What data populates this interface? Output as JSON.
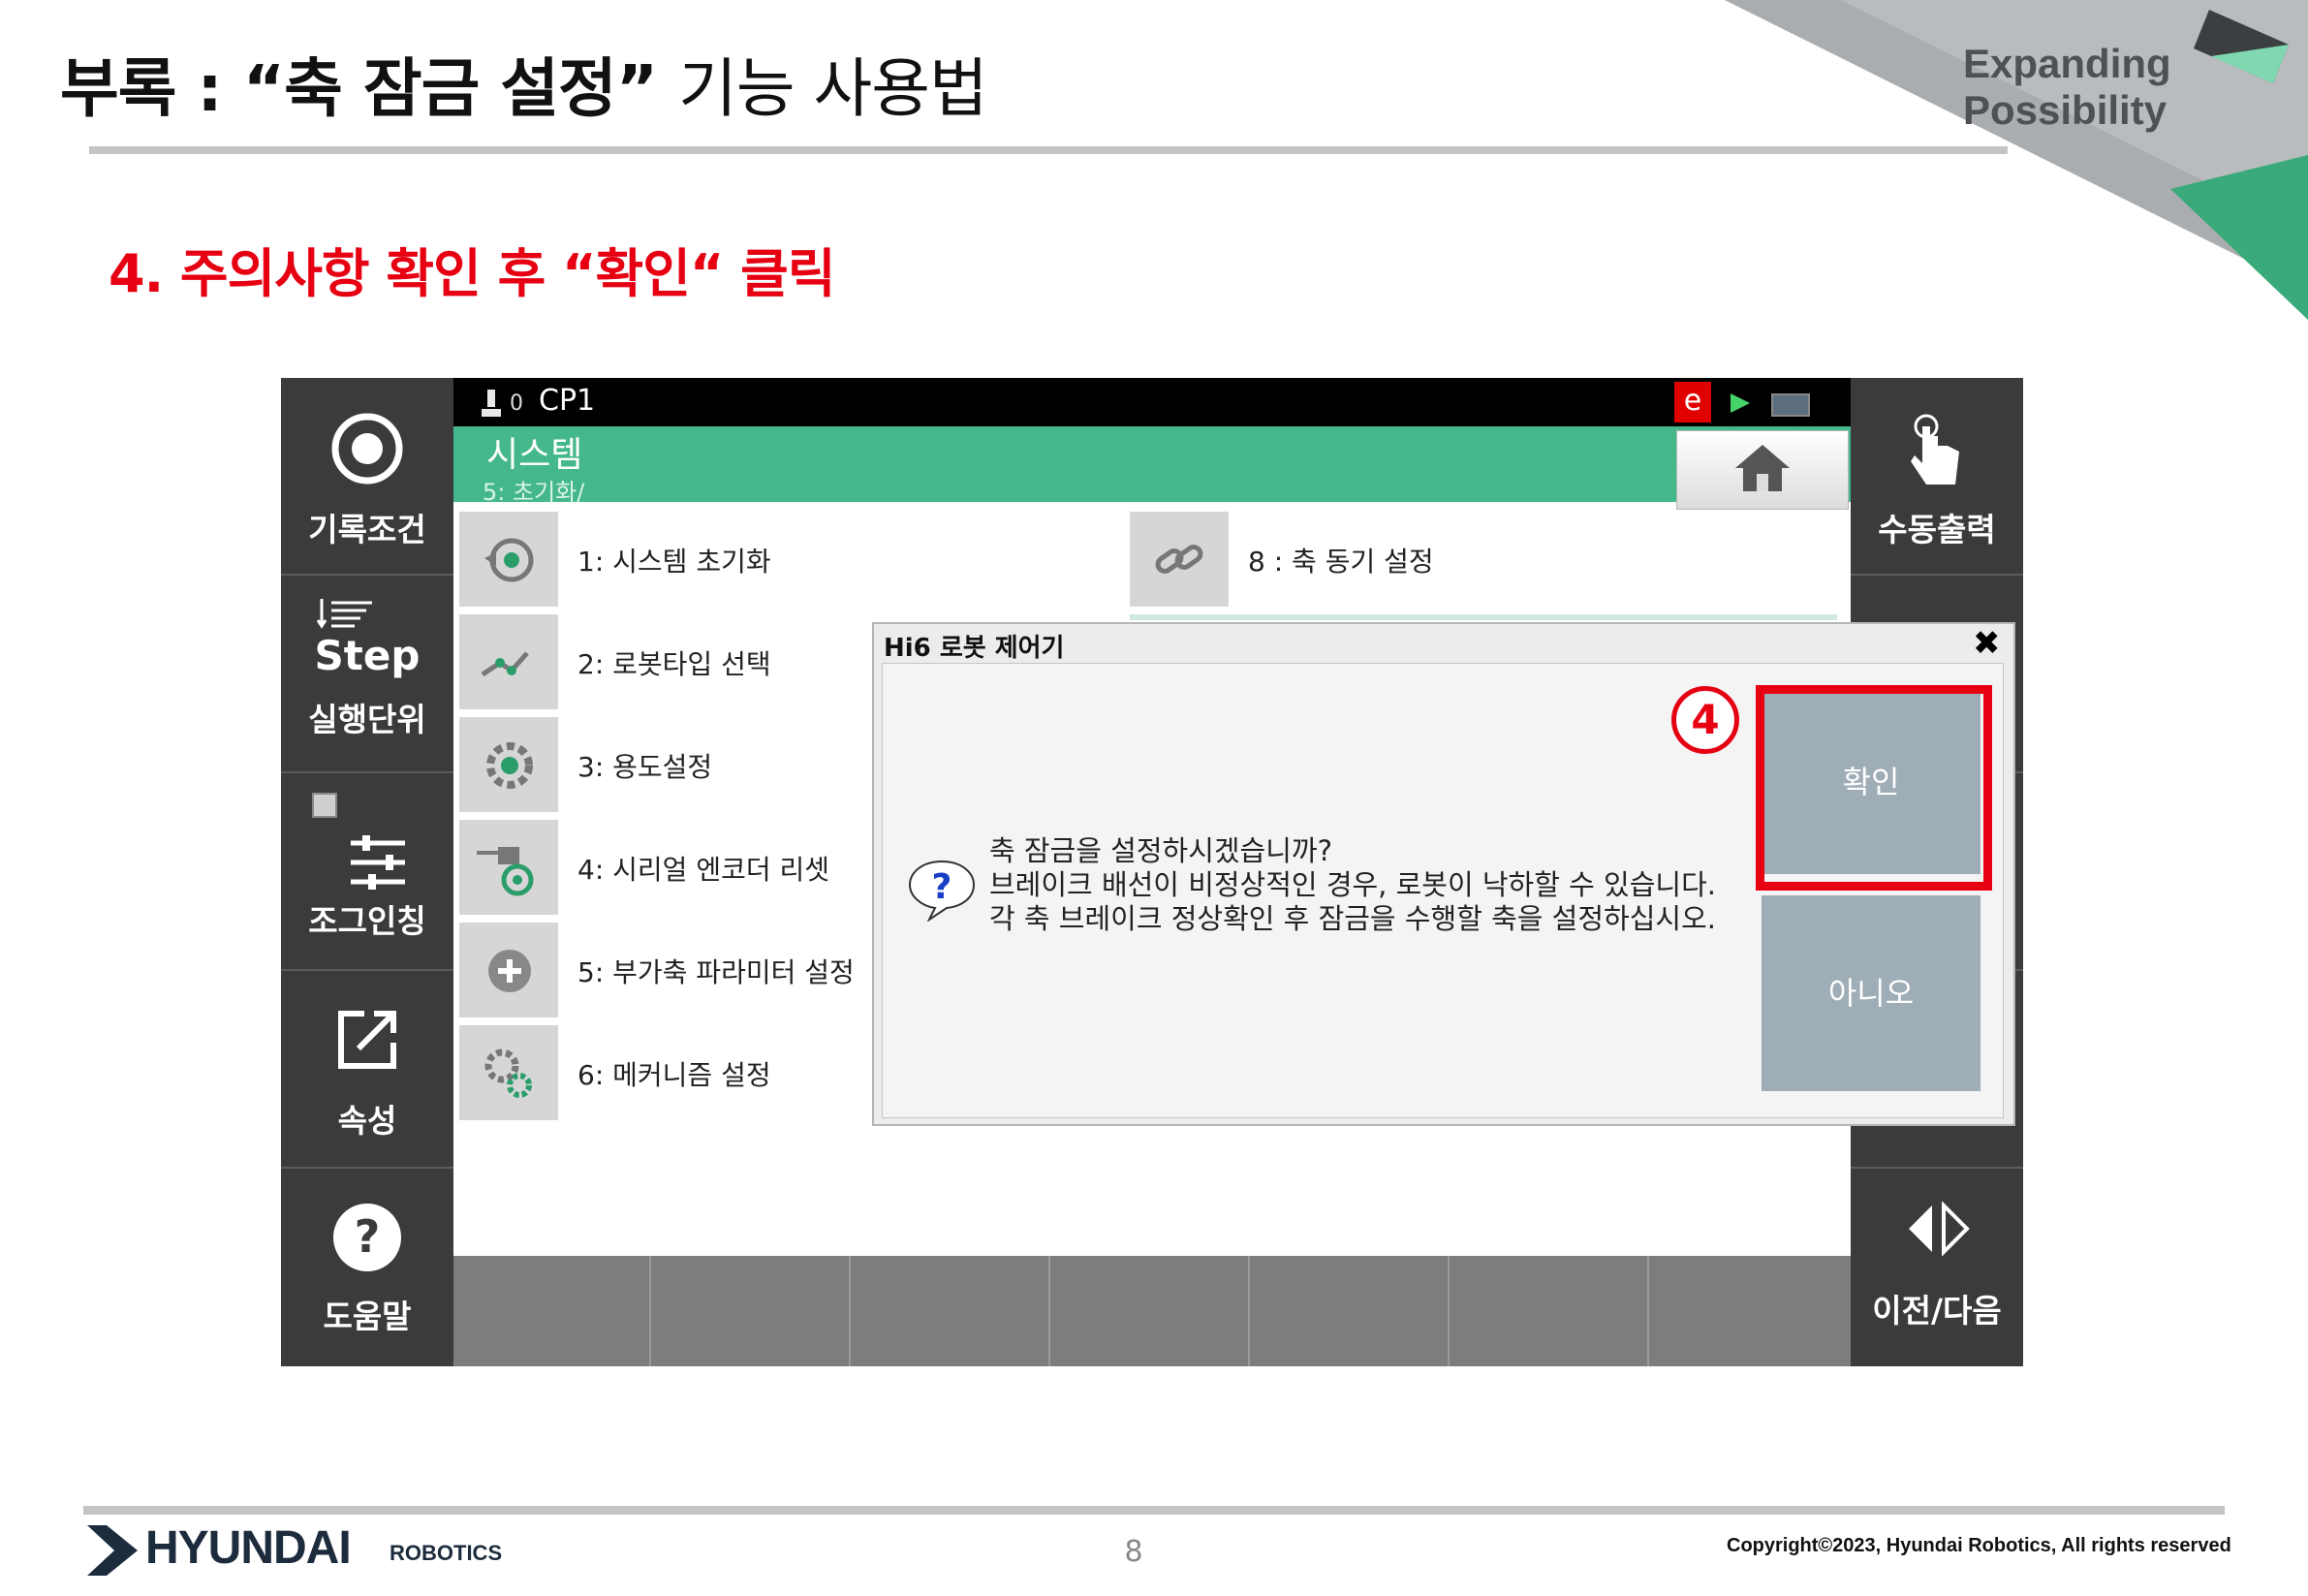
{
  "slide": {
    "title_bold": "부록 : “축 잠금 설정”",
    "title_light": "기능 사용법",
    "brand_line1": "Expanding",
    "brand_line2": "Possibility",
    "step_heading": "4. 주의사항 확인 후 “확인“ 클릭",
    "page_number": "8",
    "copyright": "Copyright©2023, Hyundai Robotics, All rights reserved",
    "logo_main": "HYUNDAI",
    "logo_sub": "ROBOTICS",
    "colors": {
      "accent_red": "#e60012",
      "header_green": "#45b88b",
      "rail_dark": "#3b3b3b"
    }
  },
  "pendant": {
    "status": {
      "robot_count": "0",
      "program": "CP1",
      "badge": "e"
    },
    "header": {
      "title": "시스템",
      "path": "5: 초기화/"
    },
    "left_rail": [
      {
        "label": "기록조건",
        "icon": "record-target-icon"
      },
      {
        "label": "실행단위",
        "top_text": "Step",
        "icon": "step-icon"
      },
      {
        "label": "조그인칭",
        "icon": "sliders-icon"
      },
      {
        "label": "속성",
        "icon": "edit-external-icon"
      },
      {
        "label": "도움말",
        "icon": "help-icon"
      }
    ],
    "right_rail": [
      {
        "label": "수동출력",
        "icon": "touch-hand-icon"
      },
      {
        "label": "이전/다음",
        "icon": "prev-next-icon"
      }
    ],
    "menu": [
      {
        "label": "1: 시스템 초기화"
      },
      {
        "label": "2: 로봇타입 선택"
      },
      {
        "label": "3: 용도설정"
      },
      {
        "label": "4: 시리얼 엔코더 리셋"
      },
      {
        "label": "5: 부가축 파라미터 설정"
      },
      {
        "label": "6: 메커니즘 설정"
      },
      {
        "label": "8 : 축 동기 설정"
      }
    ]
  },
  "dialog": {
    "title": "Hi6 로봇 제어기",
    "close": "✖",
    "message_line1": "축 잠금을 설정하시겠습니까?",
    "message_line2": "브레이크 배선이 비정상적인 경우, 로봇이 낙하할 수 있습니다.",
    "message_line3": "각 축 브레이크 정상확인 후 잠금을 수행할 축을 설정하십시오.",
    "ok_label": "확인",
    "no_label": "아니오",
    "step_marker": "4"
  }
}
